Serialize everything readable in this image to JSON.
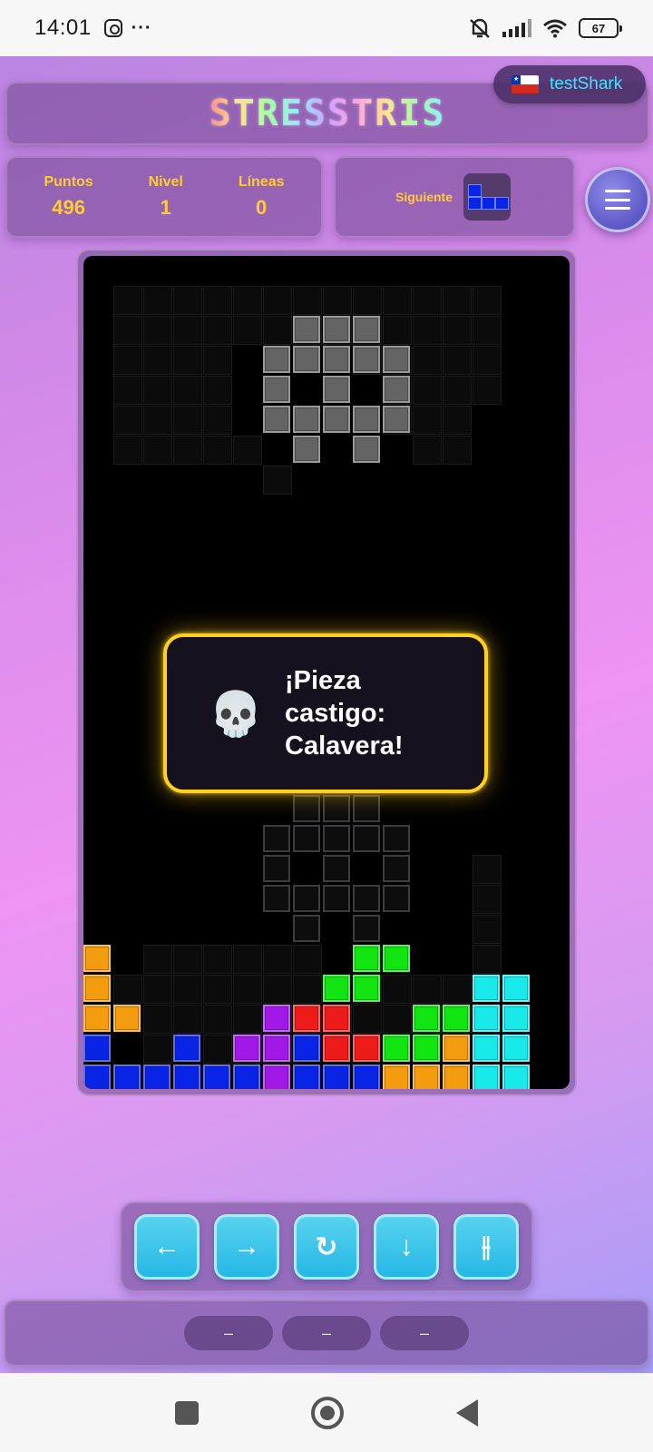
{
  "status_bar": {
    "time": "14:01",
    "dots": "···",
    "battery": "67",
    "icons": [
      "instagram-icon",
      "more-icon",
      "mute-icon",
      "signal-icon",
      "wifi-icon",
      "battery-icon"
    ]
  },
  "header": {
    "logo_text": "STRESSTRIS",
    "user": {
      "flag": "chile-flag-icon",
      "name": "testShark"
    }
  },
  "stats": {
    "points_label": "Puntos",
    "points_value": "496",
    "level_label": "Nivel",
    "level_value": "1",
    "lines_label": "Líneas",
    "lines_value": "0"
  },
  "next": {
    "label": "Siguiente",
    "piece": "J",
    "color": "#0a24e6"
  },
  "menu": {
    "icon": "hamburger-menu-icon"
  },
  "board": {
    "columns": 15,
    "rows": 28,
    "falling_piece": "skull",
    "ghost_piece": "skull",
    "colors": {
      "orange": "#f39c0f",
      "blue": "#0a24e6",
      "purple": "#a119e6",
      "red": "#ee1b1b",
      "green": "#12e412",
      "cyan": "#1ae9ea",
      "gray": "#646464"
    }
  },
  "toast": {
    "icon": "💀",
    "text": "¡Pieza castigo: Calavera!"
  },
  "controls": {
    "left": "←",
    "right": "→",
    "rotate": "↻",
    "down": "↓",
    "hold": "⫲"
  },
  "bottom_pills": [
    "–",
    "–",
    "–"
  ],
  "nav": [
    "recents-icon",
    "home-icon",
    "back-icon"
  ]
}
